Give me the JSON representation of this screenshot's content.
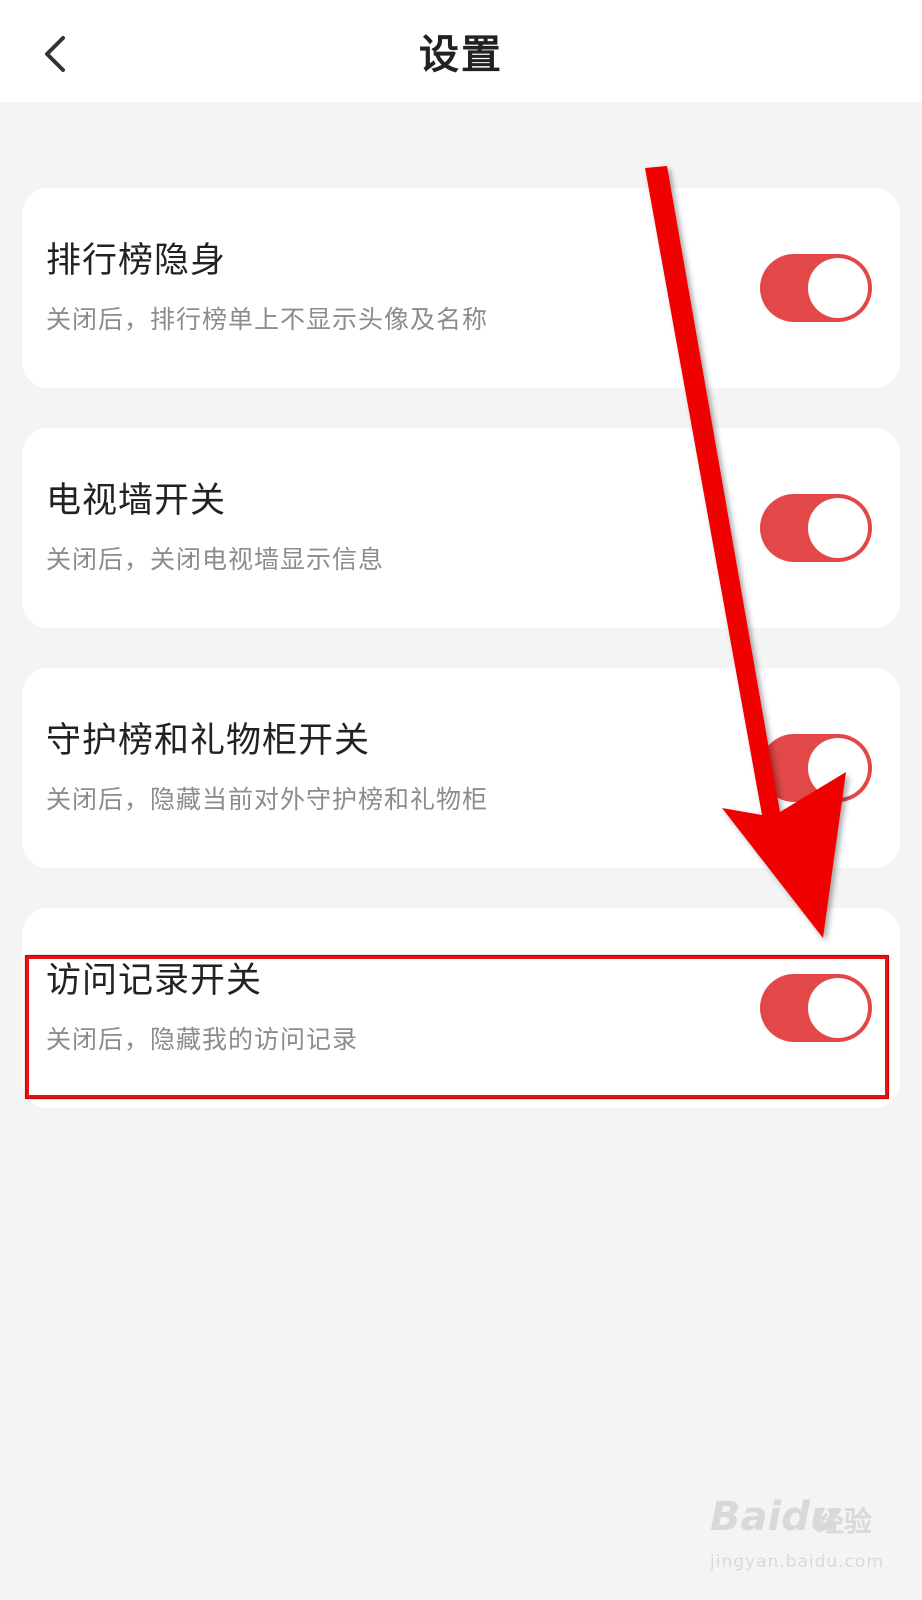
{
  "header": {
    "title": "设置",
    "back_icon": "chevron-left-icon"
  },
  "settings": [
    {
      "title": "排行榜隐身",
      "description": "关闭后，排行榜单上不显示头像及名称",
      "enabled": true
    },
    {
      "title": "电视墙开关",
      "description": "关闭后，关闭电视墙显示信息",
      "enabled": true
    },
    {
      "title": "守护榜和礼物柜开关",
      "description": "关闭后，隐藏当前对外守护榜和礼物柜",
      "enabled": true
    },
    {
      "title": "访问记录开关",
      "description": "关闭后，隐藏我的访问记录",
      "enabled": true
    }
  ],
  "colors": {
    "toggle_on": "#e24848",
    "annotation": "#e81010",
    "background": "#f4f4f4"
  },
  "watermark": {
    "logo": "Baidu",
    "suffix": "经验",
    "url": "jingyan.baidu.com"
  }
}
